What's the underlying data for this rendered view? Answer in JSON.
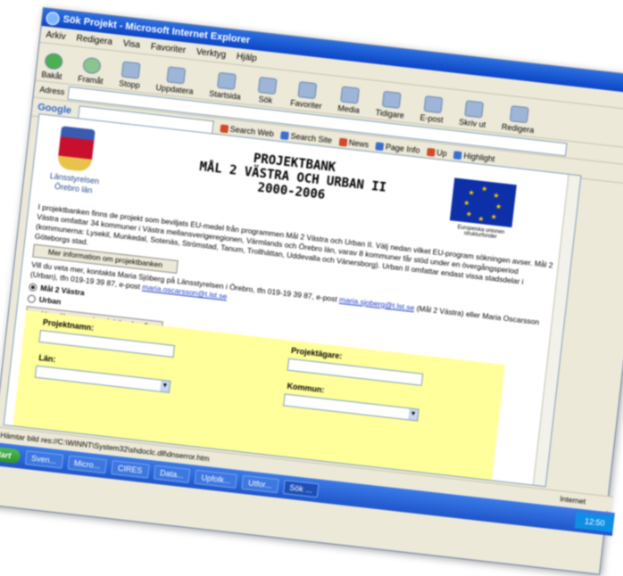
{
  "window": {
    "title": "Sök Projekt - Microsoft Internet Explorer"
  },
  "menu": [
    "Arkiv",
    "Redigera",
    "Visa",
    "Favoriter",
    "Verktyg",
    "Hjälp"
  ],
  "toolbar": {
    "back": "Bakåt",
    "forward": "Framåt",
    "stop": "Stopp",
    "refresh": "Uppdatera",
    "home": "Startsida",
    "search": "Sök",
    "favorites": "Favoriter",
    "media": "Media",
    "history": "Tidigare",
    "email": "E-post",
    "print": "Skriv ut",
    "edit": "Redigera"
  },
  "address": {
    "label": "Adress",
    "value": ""
  },
  "google": {
    "logo": "Google",
    "search_web": "Search Web",
    "search_site": "Search Site",
    "news": "News",
    "page_info": "Page Info",
    "up": "Up",
    "highlight": "Highlight"
  },
  "page": {
    "county_caption": "Länsstyrelsen Örebro län",
    "heading": [
      "PROJEKTBANK",
      "MÅL 2 VÄSTRA OCH URBAN II",
      "2000-2006"
    ],
    "eu_caption": "Europeiska unionen strukturfonder",
    "intro": "I projektbanken finns de projekt som beviljats EU-medel från programmen Mål 2 Västra och Urban II. Välj nedan vilket EU-program sökningen avser. Mål 2 Västra omfattar 34 kommuner i Västra mellansverigeregionen, Värmlands och Örebro län, varav 8 kommuner får stöd under en övergångsperiod (kommunerna: Lysekil, Munkedal, Sotenäs, Strömstad, Tanum, Trollhättan, Uddevalla och Vänersborg). Urban II omfattar endast vissa stadsdelar i Göteborgs stad.",
    "more_info_button": "Mer information om projektbanken",
    "contact_text": "Vill du veta mer, kontakta Maria Sjöberg på Länsstyrelsen i Örebro, tfn 019-19 39 87, e-post",
    "contact_email1": "maria.sjoberg@t.lst.se",
    "contact_text2": "(Mål 2 Västra) eller Maria Oscarsson (Urban), tfn 019-19 39 87, e-post",
    "contact_email2": "maria.oscarsson@t.lst.se",
    "radio_mal2": "Mål 2 Västra",
    "radio_urban": "Urban",
    "how_button": "Hur söker man i projektbanken?",
    "field_projektnamn": "Projektnamn:",
    "field_projektagare": "Projektägare:",
    "field_lan": "Län:",
    "field_kommun": "Kommun:"
  },
  "status": {
    "text": "Hämtar bild res://C:\\WINNT\\System32\\shdoclc.dll\\dnserror.htm",
    "zone": "Internet"
  },
  "taskbar": {
    "start": "Start",
    "tasks": [
      "Sven...",
      "Micro...",
      "CIRES",
      "Data...",
      "Upfolk...",
      "Utfor...",
      "Sök ..."
    ],
    "clock": "12:50"
  }
}
